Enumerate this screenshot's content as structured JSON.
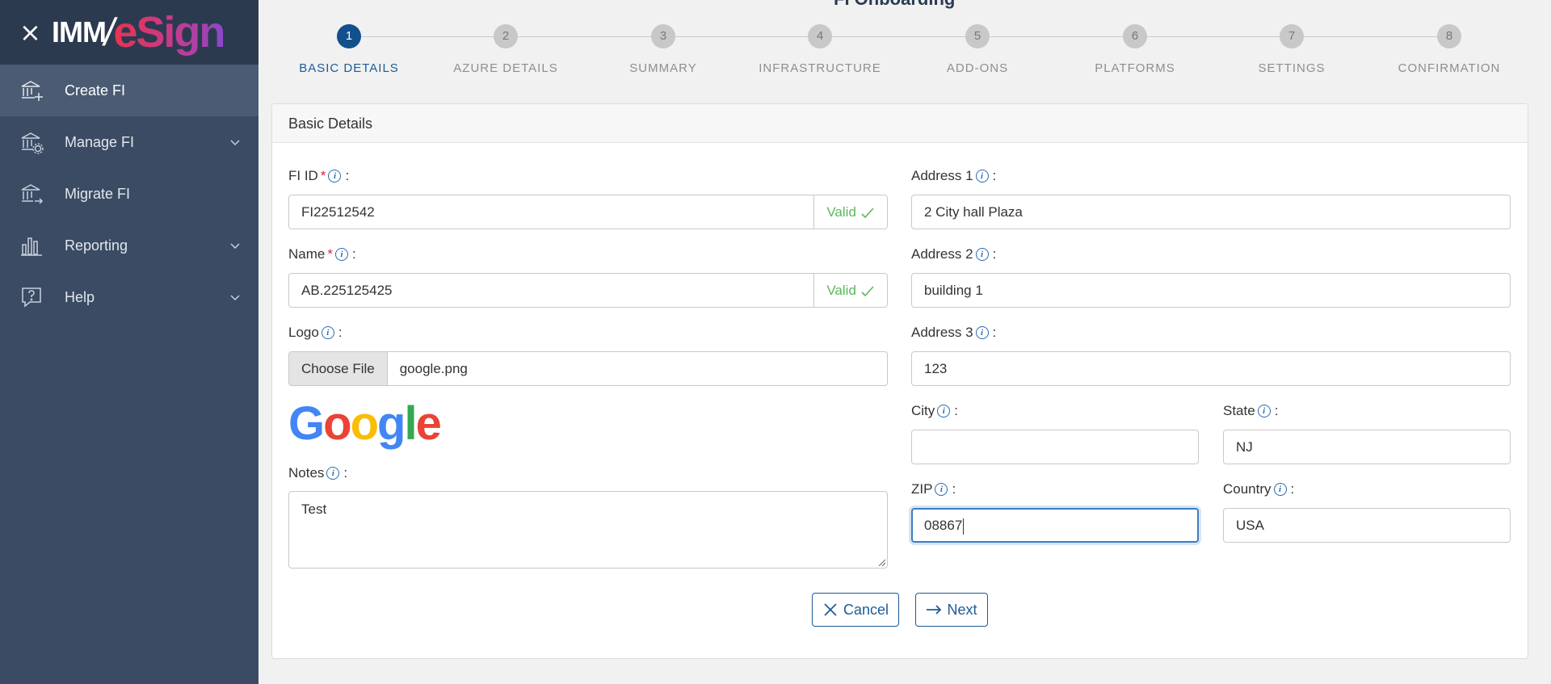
{
  "app": {
    "logo_part1": "IMM",
    "logo_slash": "/",
    "logo_part2": "eSign"
  },
  "sidebar": {
    "items": [
      {
        "label": "Create FI",
        "icon": "bank-plus-icon",
        "active": true
      },
      {
        "label": "Manage FI",
        "icon": "bank-settings-icon",
        "has_submenu": true
      },
      {
        "label": "Migrate FI",
        "icon": "bank-arrow-icon"
      },
      {
        "label": "Reporting",
        "icon": "bar-chart-icon",
        "has_submenu": true
      },
      {
        "label": "Help",
        "icon": "help-chat-icon",
        "has_submenu": true
      }
    ]
  },
  "page": {
    "title": "FI Onboarding"
  },
  "stepper": {
    "steps": [
      {
        "num": "1",
        "label": "BASIC DETAILS",
        "active": true
      },
      {
        "num": "2",
        "label": "AZURE DETAILS"
      },
      {
        "num": "3",
        "label": "SUMMARY"
      },
      {
        "num": "4",
        "label": "INFRASTRUCTURE"
      },
      {
        "num": "5",
        "label": "ADD-ONS"
      },
      {
        "num": "6",
        "label": "PLATFORMS"
      },
      {
        "num": "7",
        "label": "SETTINGS"
      },
      {
        "num": "8",
        "label": "CONFIRMATION"
      }
    ]
  },
  "card": {
    "title": "Basic Details"
  },
  "form": {
    "fi_id": {
      "label": "FI ID",
      "required": "*",
      "value": "FI22512542",
      "status": "Valid"
    },
    "name": {
      "label": "Name",
      "required": "*",
      "value": "AB.225125425",
      "status": "Valid"
    },
    "logo": {
      "label": "Logo",
      "button": "Choose File",
      "file_name": "google.png",
      "preview_letters": [
        "G",
        "o",
        "o",
        "g",
        "l",
        "e"
      ]
    },
    "notes": {
      "label": "Notes",
      "value": "Test"
    },
    "address1": {
      "label": "Address 1",
      "value": "2 City hall Plaza"
    },
    "address2": {
      "label": "Address 2",
      "value": "building 1"
    },
    "address3": {
      "label": "Address 3",
      "value": "123"
    },
    "city": {
      "label": "City",
      "value": ""
    },
    "state": {
      "label": "State",
      "value": "NJ"
    },
    "zip": {
      "label": "ZIP",
      "value": "08867"
    },
    "country": {
      "label": "Country",
      "value": "USA"
    }
  },
  "actions": {
    "cancel": "Cancel",
    "next": "Next"
  },
  "colors": {
    "sidebar_bg": "#3a4b63",
    "sidebar_header_bg": "#2c3a50",
    "active_step": "#12508d",
    "valid": "#5cb85c",
    "required": "#d9233a",
    "google_blue": "#4285F4",
    "google_red": "#EA4335",
    "google_yellow": "#FBBC05",
    "google_green": "#34A853"
  }
}
